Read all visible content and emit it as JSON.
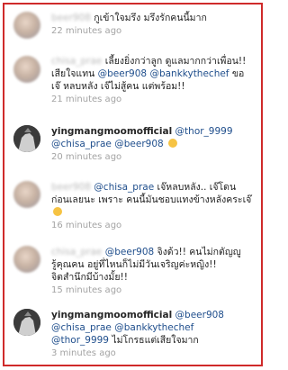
{
  "comments": [
    {
      "username": "beer908",
      "text": "กูเข้าใจมรึง มรึงรักคนนี้มาก",
      "time": "22 minutes ago"
    },
    {
      "username": "chisa_prae",
      "text": "เลี้ยงยิ่งกว่าลูก ดูแลมากกว่าเพื่อน!! เสียใจแทน",
      "mentions": [
        "@beer908",
        "@bankkythechef"
      ],
      "text2": "ขอเจ๊ หลบหลัง เจ๊ไม่สู้คน แต่พร้อม!!",
      "time": "21 minutes ago"
    },
    {
      "username": "yingmangmoomofficial",
      "mentions": [
        "@thor_9999",
        "@chisa_prae",
        "@beer908"
      ],
      "emoji": "smiling-face",
      "time": "20 minutes ago"
    },
    {
      "username": "beer908",
      "mentions": [
        "@chisa_prae"
      ],
      "text": "เจ๊หลบหลัง.. เจ๊โดนก่อนเลยนะ เพราะ คนนี้มันชอบแทงข้างหลังคระเจ๊",
      "emoji": "smiling-face",
      "time": "16 minutes ago"
    },
    {
      "username": "chisa_prae",
      "mentions": [
        "@beer908"
      ],
      "text": "จิงด้ว!! คนไม่กตัญญูรู้คุณคน อยู่ที่ไหนก็ไม่มีวันเจริญค่ะหญิง!! จิตสำนึกมีบ้างมั้ย!!",
      "time": "15 minutes ago"
    },
    {
      "username": "yingmangmoomofficial",
      "mentions": [
        "@beer908",
        "@chisa_prae",
        "@bankkythechef",
        "@thor_9999"
      ],
      "text": "ไม่โกรธแต่เสียใจมาก",
      "time": "3 minutes ago"
    }
  ],
  "colors": {
    "frame": "#cf2a2a",
    "mention": "#1f4e8c",
    "time": "#a3a3a3"
  }
}
